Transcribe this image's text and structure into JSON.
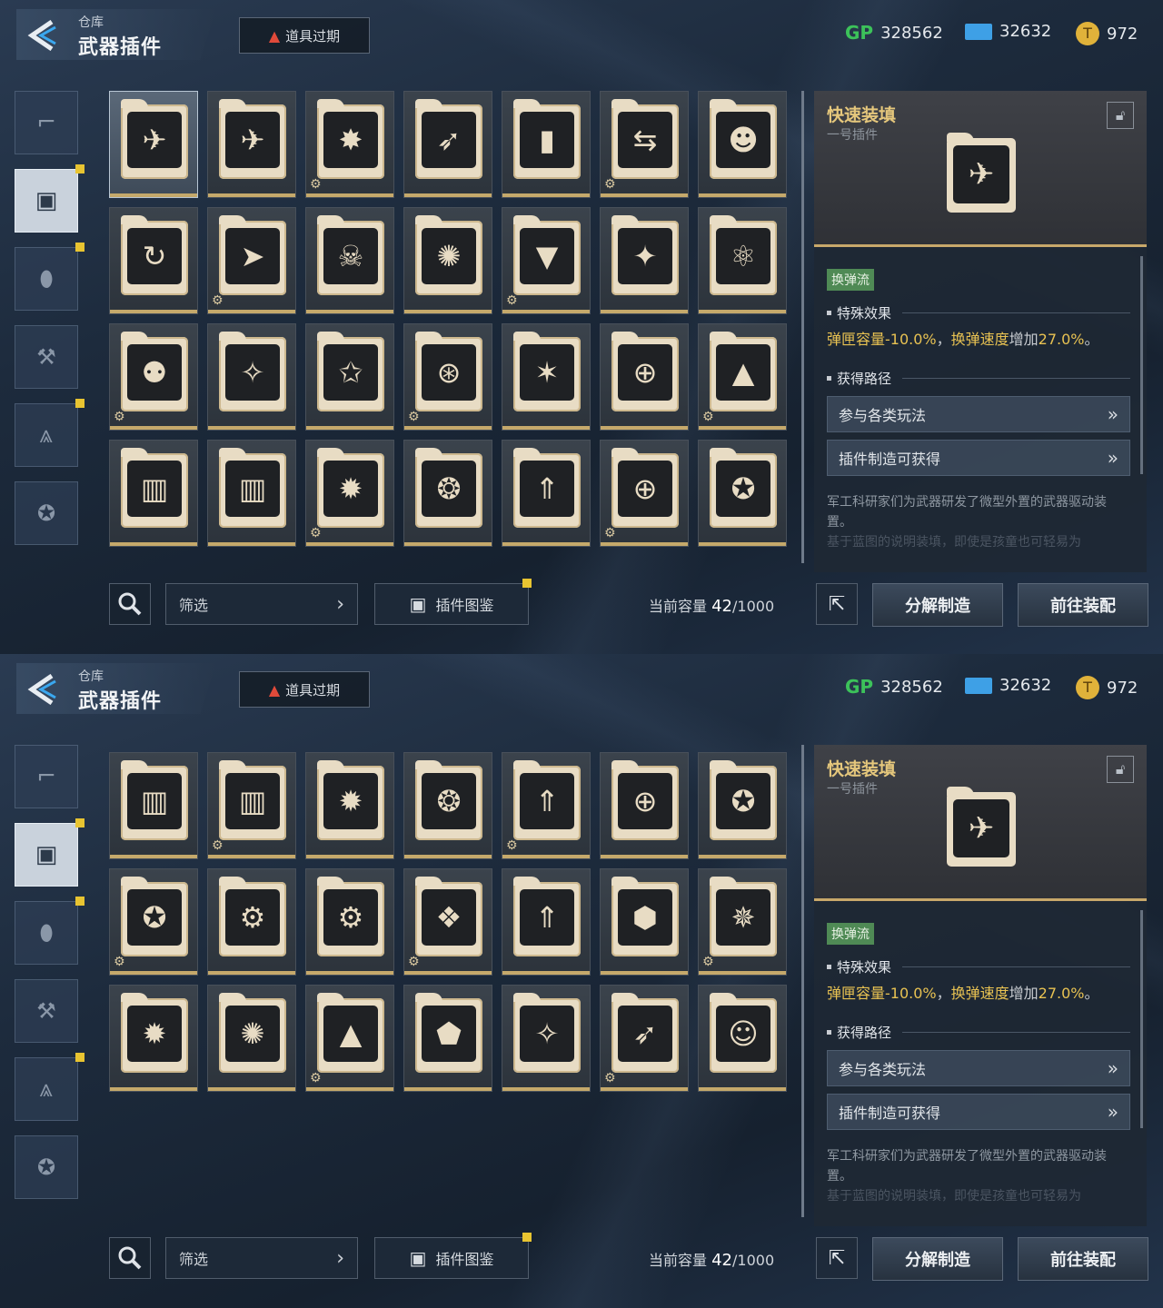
{
  "header": {
    "breadcrumb": "仓库",
    "title": "武器插件",
    "expire_label": "道具过期"
  },
  "currencies": [
    {
      "icon": "GP",
      "value": "328562",
      "color": "#3cc25a"
    },
    {
      "icon": "ticket-icon",
      "value": "32632",
      "color": "#3ea0e6"
    },
    {
      "icon": "coin-icon",
      "value": "972",
      "color": "#e0b23a"
    }
  ],
  "nav": [
    {
      "name": "pistol-icon",
      "badge": false
    },
    {
      "name": "plugin-icon",
      "badge": true,
      "active": true
    },
    {
      "name": "grenade-icon",
      "badge": true
    },
    {
      "name": "gun-mod-icon",
      "badge": false
    },
    {
      "name": "compass-icon",
      "badge": true
    },
    {
      "name": "star-badge-icon",
      "badge": false
    }
  ],
  "grid1_glyphs": [
    "✈",
    "✈",
    "✸",
    "➶",
    "▮",
    "⇆",
    "☻",
    "↻",
    "➤",
    "☠",
    "✺",
    "▼",
    "✦",
    "⚛",
    "⚉",
    "✧",
    "✩",
    "⊛",
    "✶",
    "⊕",
    "▲",
    "▥",
    "▥",
    "✹",
    "❂",
    "⇑",
    "⊕",
    "✪"
  ],
  "grid2_glyphs": [
    "⚉",
    "✧",
    "✩",
    "⊛",
    "✶",
    "⊕",
    "▲",
    "▥",
    "▥",
    "✹",
    "❂",
    "⇑",
    "⊕",
    "✪",
    "✪",
    "⚙",
    "⚙",
    "❖",
    "⇑",
    "⬢",
    "✵",
    "✹",
    "✺",
    "▲",
    "⬟",
    "✧",
    "➶",
    "☺"
  ],
  "detail": {
    "name": "快速装填",
    "subtitle": "一号插件",
    "tag": "换弹流",
    "effect_title": "特殊效果",
    "effect_a": "弹匣容量",
    "effect_a_val": "-10.0%",
    "sep": "，",
    "effect_b": "换弹速度",
    "effect_b_mid": "增加",
    "effect_b_val": "27.0%",
    "end": "。",
    "source_title": "获得路径",
    "source1": "参与各类玩法",
    "source2": "插件制造可获得",
    "desc1": "军工科研家们为武器研发了微型外置的武器驱动装置。",
    "desc2": "基于蓝图的说明装填，即使是孩童也可轻易为"
  },
  "bottom": {
    "filter": "筛选",
    "atlas": "插件图鉴",
    "cap_label": "当前容量",
    "cap_cur": "42",
    "cap_max": "/1000",
    "btn_craft": "分解制造",
    "btn_equip": "前往装配"
  }
}
